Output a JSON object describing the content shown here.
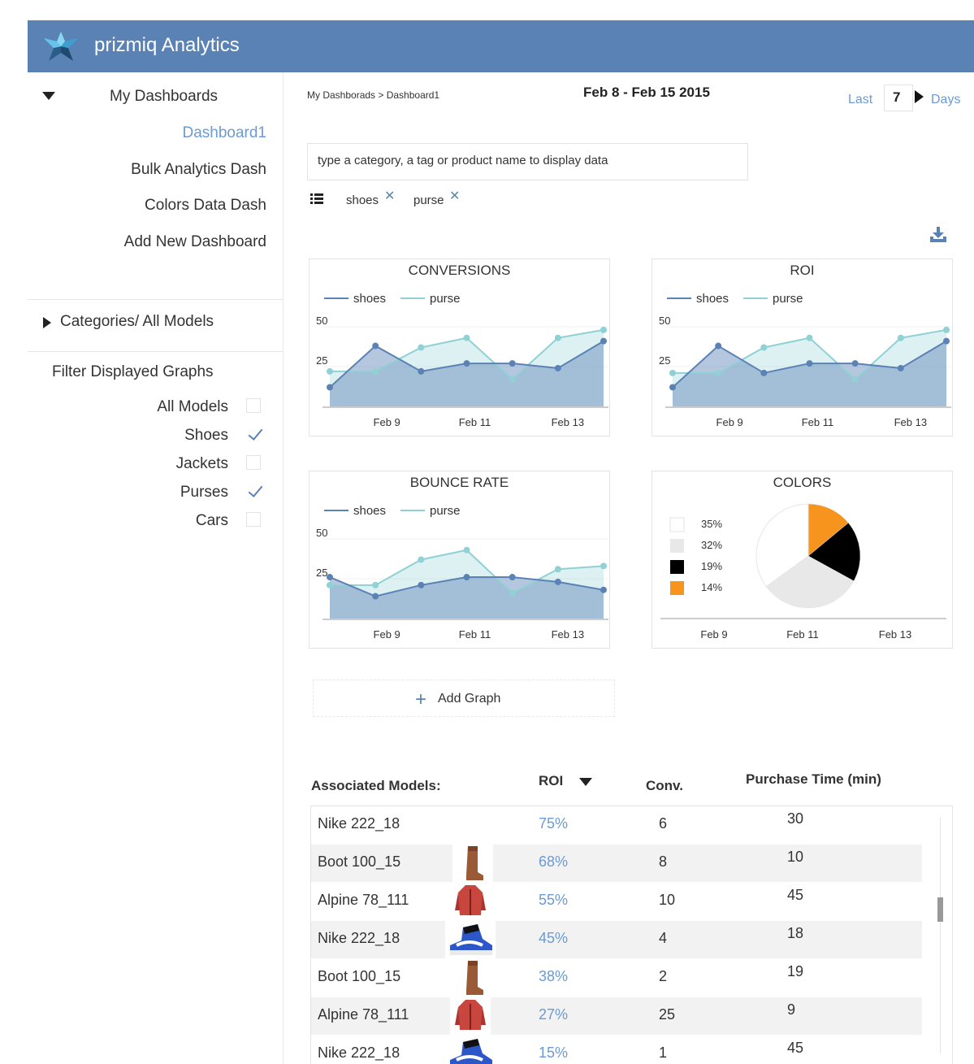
{
  "app": {
    "title": "prizmiq Analytics"
  },
  "sidebar": {
    "dashboards_header": "My Dashboards",
    "dashboards": [
      {
        "label": "Dashboard1",
        "active": true
      },
      {
        "label": "Bulk Analytics Dash",
        "active": false
      },
      {
        "label": "Colors Data Dash",
        "active": false
      },
      {
        "label": "Add New Dashboard",
        "active": false
      }
    ],
    "categories_label": "Categories/ All Models",
    "filter_title": "Filter Displayed Graphs",
    "filters": [
      {
        "label": "All Models",
        "checked": false
      },
      {
        "label": "Shoes",
        "checked": true
      },
      {
        "label": "Jackets",
        "checked": false
      },
      {
        "label": "Purses",
        "checked": true
      },
      {
        "label": "Cars",
        "checked": false
      }
    ]
  },
  "header": {
    "breadcrumb": "My Dashborads > Dashboard1",
    "date_range": "Feb 8 - Feb 15 2015",
    "last_label": "Last",
    "days_value": "7",
    "days_label": "Days"
  },
  "search": {
    "placeholder": "type a category, a tag or product name to display data"
  },
  "tags": [
    {
      "label": "shoes"
    },
    {
      "label": "purse"
    }
  ],
  "colors": {
    "accent": "#5b82b5",
    "link": "#6b9bd2",
    "shoes": "#5b82b5",
    "purse": "#8fd1d4",
    "orange": "#f7941d"
  },
  "chart_data": [
    {
      "type": "area",
      "title": "CONVERSIONS",
      "x_ticks": [
        "Feb 9",
        "Feb 11",
        "Feb 13"
      ],
      "y_ticks": [
        "50",
        "25"
      ],
      "ylim": [
        0,
        55
      ],
      "series": [
        {
          "name": "shoes",
          "values": [
            12,
            38,
            22,
            27,
            27,
            24,
            41
          ]
        },
        {
          "name": "purse",
          "values": [
            22,
            22,
            37,
            43,
            17,
            43,
            48
          ]
        }
      ]
    },
    {
      "type": "area",
      "title": "ROI",
      "x_ticks": [
        "Feb 9",
        "Feb 11",
        "Feb 13"
      ],
      "y_ticks": [
        "50",
        "25"
      ],
      "ylim": [
        0,
        55
      ],
      "series": [
        {
          "name": "shoes",
          "values": [
            12,
            38,
            21,
            27,
            27,
            24,
            41
          ]
        },
        {
          "name": "purse",
          "values": [
            21,
            21,
            37,
            43,
            17,
            43,
            48
          ]
        }
      ]
    },
    {
      "type": "area",
      "title": "BOUNCE RATE",
      "x_ticks": [
        "Feb 9",
        "Feb 11",
        "Feb 13"
      ],
      "y_ticks": [
        "50",
        "25"
      ],
      "ylim": [
        0,
        55
      ],
      "series": [
        {
          "name": "shoes",
          "values": [
            26,
            14,
            21,
            26,
            26,
            23,
            18
          ]
        },
        {
          "name": "purse",
          "values": [
            21,
            21,
            37,
            43,
            16,
            31,
            33
          ]
        }
      ]
    },
    {
      "type": "pie",
      "title": "COLORS",
      "x_ticks": [
        "Feb 9",
        "Feb 11",
        "Feb 13"
      ],
      "slices": [
        {
          "label": "35%",
          "value": 35,
          "color": "#ffffff"
        },
        {
          "label": "32%",
          "value": 32,
          "color": "#e8e8e8"
        },
        {
          "label": "19%",
          "value": 19,
          "color": "#000000"
        },
        {
          "label": "14%",
          "value": 14,
          "color": "#f7941d"
        }
      ]
    }
  ],
  "add_graph": {
    "label": "Add Graph"
  },
  "table": {
    "headers": {
      "model": "Associated Models:",
      "roi": "ROI",
      "conv": "Conv.",
      "time": "Purchase Time (min)"
    },
    "rows": [
      {
        "model": "Nike 222_18",
        "roi": "75%",
        "conv": "6",
        "time": "30",
        "thumb": ""
      },
      {
        "model": "Boot 100_15",
        "roi": "68%",
        "conv": "8",
        "time": "10",
        "thumb": "boot"
      },
      {
        "model": "Alpine 78_111",
        "roi": "55%",
        "conv": "10",
        "time": "45",
        "thumb": "jacket"
      },
      {
        "model": "Nike 222_18",
        "roi": "45%",
        "conv": "4",
        "time": "18",
        "thumb": "sneaker"
      },
      {
        "model": "Boot 100_15",
        "roi": "38%",
        "conv": "2",
        "time": "19",
        "thumb": "boot"
      },
      {
        "model": "Alpine 78_111",
        "roi": "27%",
        "conv": "25",
        "time": "9",
        "thumb": "jacket"
      },
      {
        "model": "Nike 222_18",
        "roi": "15%",
        "conv": "1",
        "time": "45",
        "thumb": "sneaker"
      }
    ]
  }
}
